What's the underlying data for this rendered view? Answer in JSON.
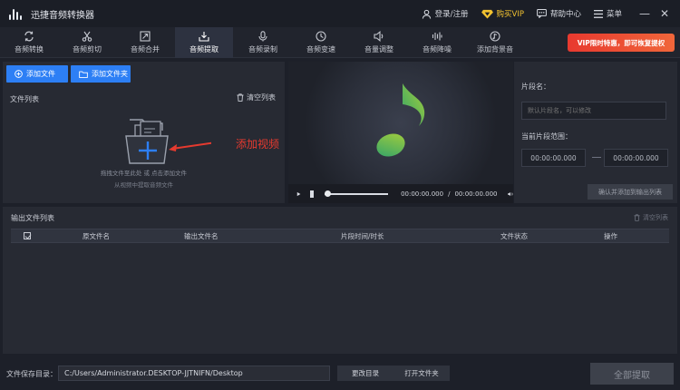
{
  "app": {
    "title": "迅捷音频转换器"
  },
  "titlebar": {
    "login": "登录/注册",
    "vip": "购买VIP",
    "help": "帮助中心",
    "menu": "菜单",
    "minimize_glyph": "—",
    "close_glyph": "✕"
  },
  "tabs": [
    {
      "label": "音频转换",
      "icon": "convert-icon"
    },
    {
      "label": "音频剪切",
      "icon": "scissors-icon"
    },
    {
      "label": "音频合并",
      "icon": "merge-icon"
    },
    {
      "label": "音频提取",
      "icon": "extract-icon",
      "active": true
    },
    {
      "label": "音频录制",
      "icon": "microphone-icon"
    },
    {
      "label": "音频变速",
      "icon": "speed-icon"
    },
    {
      "label": "音量调整",
      "icon": "volume-icon"
    },
    {
      "label": "音频降噪",
      "icon": "denoise-icon"
    },
    {
      "label": "添加背景音",
      "icon": "background-music-icon"
    }
  ],
  "vip_banner": "VIP限时特惠，即可恢复提权",
  "left": {
    "add_file": "添加文件",
    "add_folder": "添加文件夹",
    "file_list_label": "文件列表",
    "clear_list": "清空列表",
    "drop_hint_1": "拖拽文件至此处 或 点击添加文件",
    "drop_hint_2": "从视频中提取音频文件",
    "annotation": "添加视频"
  },
  "player": {
    "current_time": "00:00:00.000",
    "separator": "/",
    "total_time": "00:00:00.000",
    "progress": 0
  },
  "right": {
    "segment_name_label": "片段名：",
    "segment_name_placeholder": "默认片段名，可以修改",
    "range_label": "当前片段范围：",
    "start_time": "00:00:00.000",
    "end_time": "00:00:00.000",
    "confirm_button": "确认并添加到输出列表"
  },
  "output": {
    "title": "输出文件列表",
    "clear": "清空列表",
    "columns": [
      "原文件名",
      "输出文件名",
      "片段时间/时长",
      "文件状态",
      "操作"
    ]
  },
  "bottom": {
    "save_dir_label": "文件保存目录：",
    "save_path": "C:/Users/Administrator.DESKTOP-JJTNIFN/Desktop",
    "change_dir": "更改目录",
    "open_folder": "打开文件夹",
    "extract_all": "全部提取"
  },
  "colors": {
    "accent_blue": "#2d7ff5",
    "vip_gold": "#f2c230",
    "banner_red": "#e8392f",
    "annotation_red": "#e53a2f",
    "note_green": "#8cc63f"
  }
}
